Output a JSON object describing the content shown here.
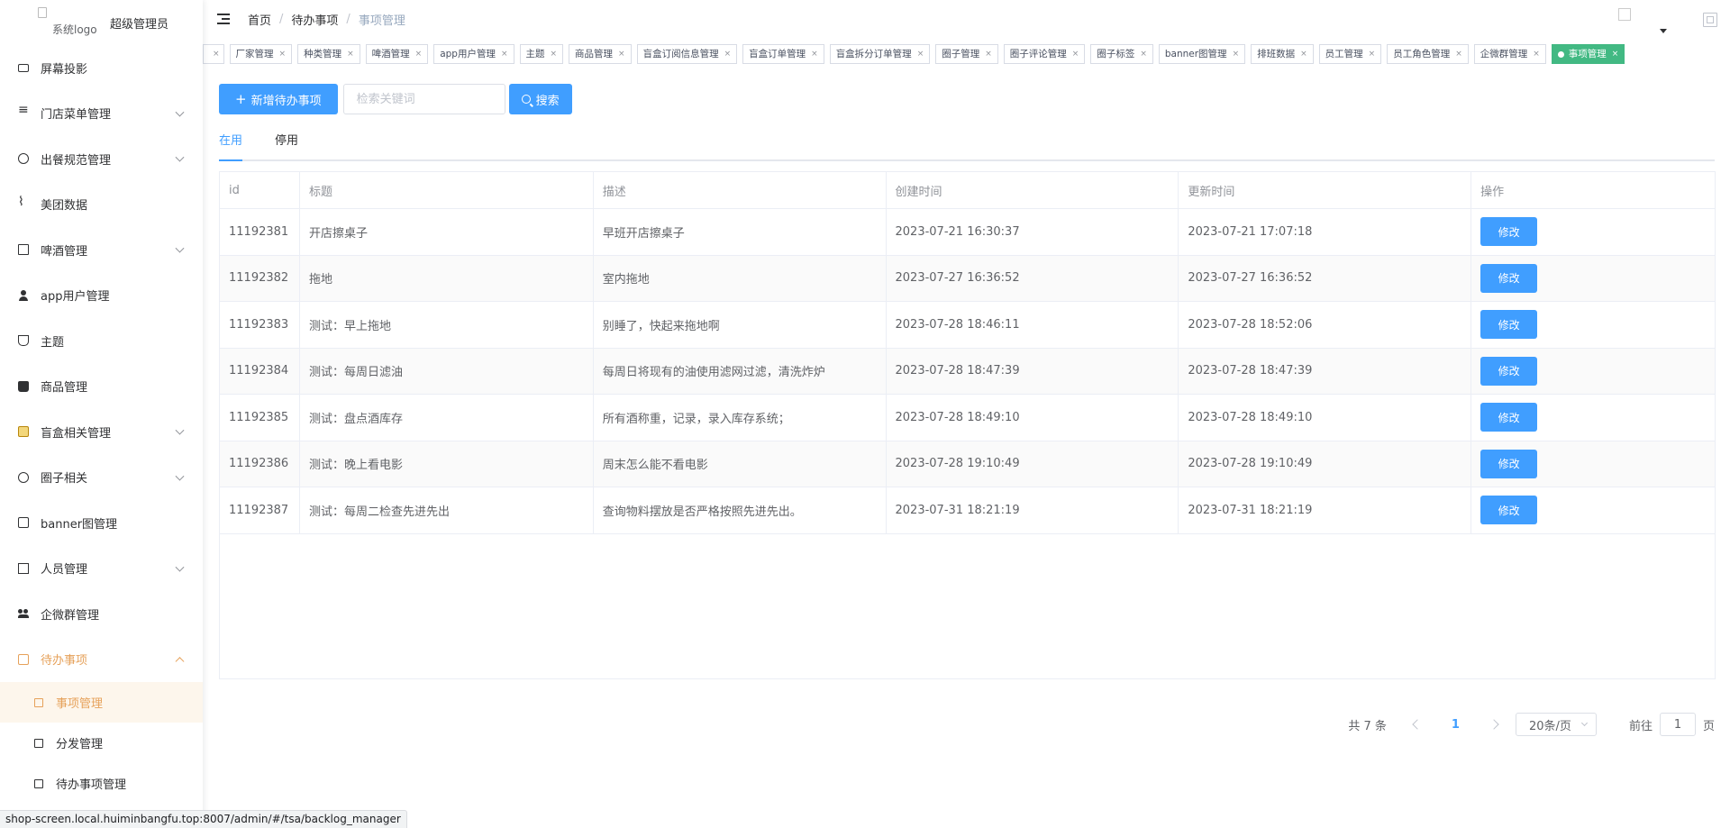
{
  "brand": {
    "logo_alt": "系统logo",
    "role": "超级管理员"
  },
  "sidebar": {
    "items": [
      {
        "label": "屏幕投影",
        "icon": "screen-icon",
        "expandable": false
      },
      {
        "label": "门店菜单管理",
        "icon": "list-icon",
        "expandable": true
      },
      {
        "label": "出餐规范管理",
        "icon": "target-icon",
        "expandable": true
      },
      {
        "label": "美团数据",
        "icon": "chart-icon",
        "expandable": false
      },
      {
        "label": "啤酒管理",
        "icon": "document-icon",
        "expandable": true
      },
      {
        "label": "app用户管理",
        "icon": "user-icon",
        "expandable": false
      },
      {
        "label": "主题",
        "icon": "trophy-icon",
        "expandable": false
      },
      {
        "label": "商品管理",
        "icon": "bag-icon",
        "expandable": false
      },
      {
        "label": "盲盒相关管理",
        "icon": "box-icon",
        "expandable": true
      },
      {
        "label": "圈子相关",
        "icon": "circle-icon",
        "expandable": true
      },
      {
        "label": "banner图管理",
        "icon": "image-icon",
        "expandable": false
      },
      {
        "label": "人员管理",
        "icon": "card-icon",
        "expandable": true
      },
      {
        "label": "企微群管理",
        "icon": "group-icon",
        "expandable": false
      },
      {
        "label": "待办事项",
        "icon": "todo-icon",
        "expandable": true,
        "expanded": true
      }
    ],
    "sub_items": [
      {
        "label": "事项管理",
        "icon": "task-icon",
        "active": true
      },
      {
        "label": "分发管理",
        "icon": "distribute-icon",
        "active": false
      },
      {
        "label": "待办事项管理",
        "icon": "checklist-icon",
        "active": false
      }
    ]
  },
  "header": {
    "breadcrumb": [
      "首页",
      "待办事项",
      "事项管理"
    ],
    "separator": "/"
  },
  "tags": [
    {
      "label": "厂家管理"
    },
    {
      "label": "种类管理"
    },
    {
      "label": "啤酒管理"
    },
    {
      "label": "app用户管理"
    },
    {
      "label": "主题"
    },
    {
      "label": "商品管理"
    },
    {
      "label": "盲盒订阅信息管理"
    },
    {
      "label": "盲盒订单管理"
    },
    {
      "label": "盲盒拆分订单管理"
    },
    {
      "label": "圈子管理"
    },
    {
      "label": "圈子评论管理"
    },
    {
      "label": "圈子标签"
    },
    {
      "label": "banner图管理"
    },
    {
      "label": "排班数据"
    },
    {
      "label": "员工管理"
    },
    {
      "label": "员工角色管理"
    },
    {
      "label": "企微群管理"
    },
    {
      "label": "事项管理",
      "active": true
    }
  ],
  "tag_close": "×",
  "toolbar": {
    "add_label": "新增待办事项",
    "search_placeholder": "检索关键词",
    "search_label": "搜索"
  },
  "tabs": [
    "在用",
    "停用"
  ],
  "table": {
    "columns": [
      "id",
      "标题",
      "描述",
      "创建时间",
      "更新时间",
      "操作"
    ],
    "rows": [
      {
        "id": "11192381",
        "title": "开店擦桌子",
        "desc": "早班开店擦桌子",
        "created": "2023-07-21 16:30:37",
        "updated": "2023-07-21 17:07:18"
      },
      {
        "id": "11192382",
        "title": "拖地",
        "desc": "室内拖地",
        "created": "2023-07-27 16:36:52",
        "updated": "2023-07-27 16:36:52"
      },
      {
        "id": "11192383",
        "title": "测试：早上拖地",
        "desc": "别睡了，快起来拖地啊",
        "created": "2023-07-28 18:46:11",
        "updated": "2023-07-28 18:52:06"
      },
      {
        "id": "11192384",
        "title": "测试：每周日滤油",
        "desc": "每周日将现有的油使用滤网过滤，清洗炸炉",
        "created": "2023-07-28 18:47:39",
        "updated": "2023-07-28 18:47:39"
      },
      {
        "id": "11192385",
        "title": "测试：盘点酒库存",
        "desc": "所有酒称重，记录，录入库存系统；",
        "created": "2023-07-28 18:49:10",
        "updated": "2023-07-28 18:49:10"
      },
      {
        "id": "11192386",
        "title": "测试：晚上看电影",
        "desc": "周末怎么能不看电影",
        "created": "2023-07-28 19:10:49",
        "updated": "2023-07-28 19:10:49"
      },
      {
        "id": "11192387",
        "title": "测试：每周二检查先进先出",
        "desc": "查询物料摆放是否严格按照先进先出。",
        "created": "2023-07-31 18:21:19",
        "updated": "2023-07-31 18:21:19"
      }
    ],
    "edit_label": "修改"
  },
  "pagination": {
    "total": "共 7 条",
    "current_page": "1",
    "page_size": "20条/页",
    "goto_prefix": "前往",
    "goto_value": "1",
    "goto_suffix": "页"
  },
  "statusbar": {
    "url": "shop-screen.local.huiminbangfu.top:8007/admin/#/tsa/backlog_manager"
  },
  "colors": {
    "primary": "#409eff",
    "active_tag": "#42b983",
    "menu_active": "#e6a15a"
  }
}
